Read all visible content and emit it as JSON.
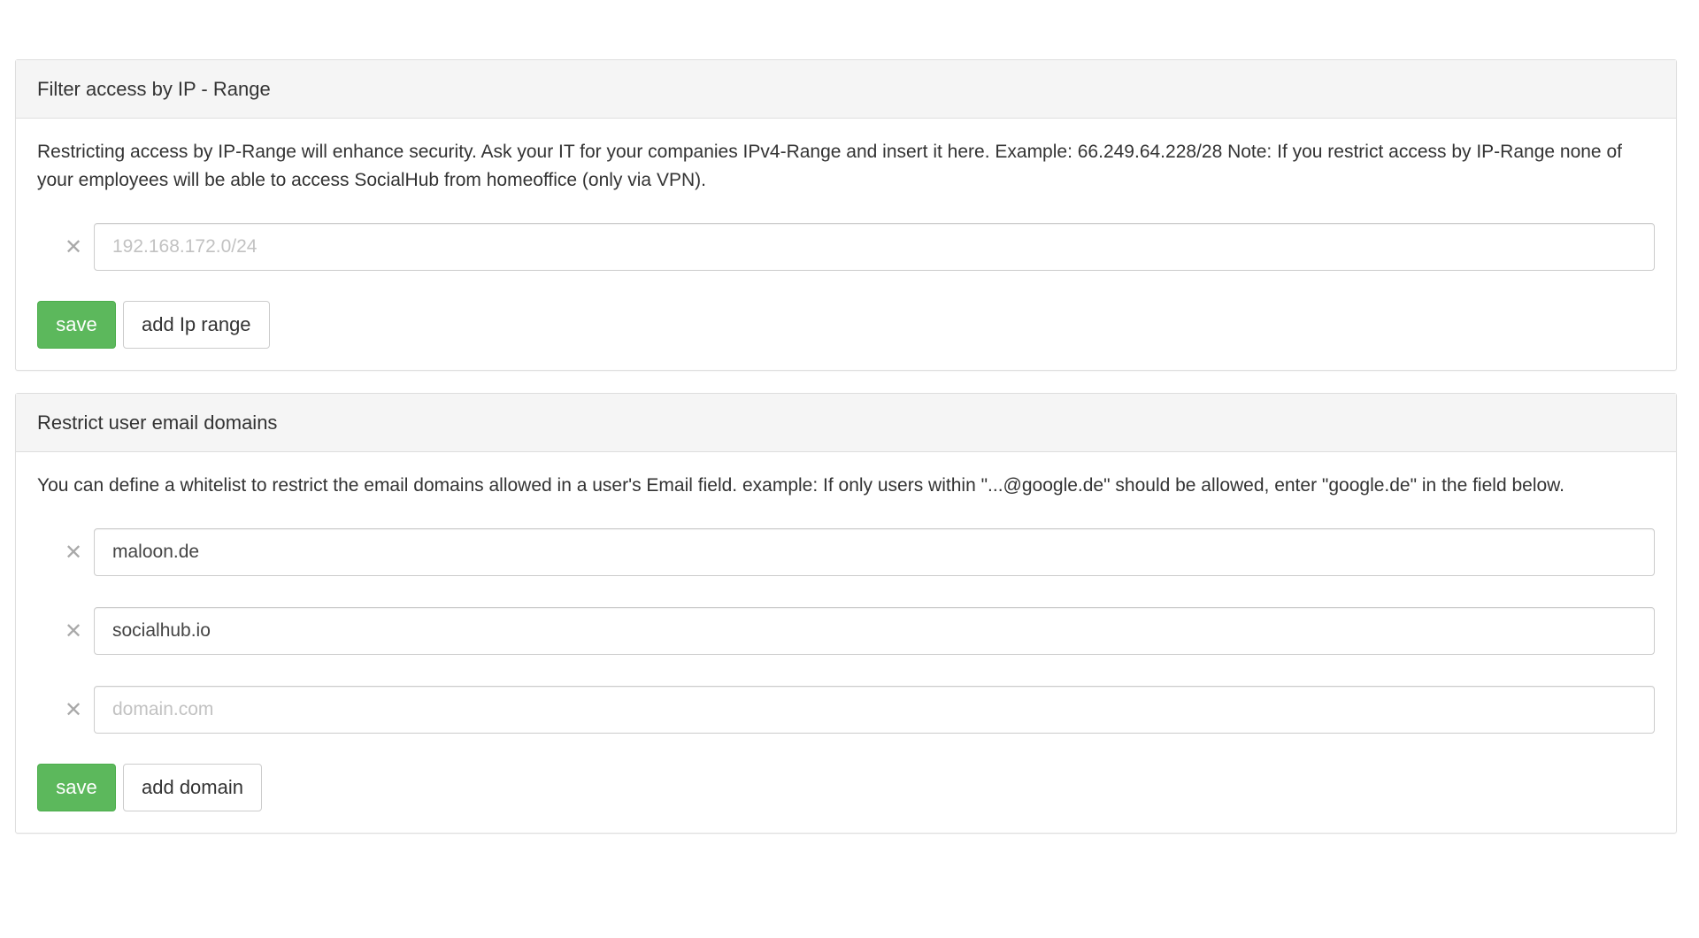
{
  "ip_panel": {
    "title": "Filter access by IP - Range",
    "description": "Restricting access by IP-Range will enhance security. Ask your IT for your companies IPv4-Range and insert it here. Example: 66.249.64.228/28 Note: If you restrict access by IP-Range none of your employees will be able to access SocialHub from homeoffice (only via VPN).",
    "fields": [
      {
        "value": "",
        "placeholder": "192.168.172.0/24"
      }
    ],
    "save_label": "save",
    "add_label": "add Ip range",
    "remove_glyph": "✕"
  },
  "email_panel": {
    "title": "Restrict user email domains",
    "description": "You can define a whitelist to restrict the email domains allowed in a user's Email field. example: If only users within \"...@google.de\" should be allowed, enter \"google.de\" in the field below.",
    "fields": [
      {
        "value": "maloon.de",
        "placeholder": ""
      },
      {
        "value": "socialhub.io",
        "placeholder": ""
      },
      {
        "value": "",
        "placeholder": "domain.com"
      }
    ],
    "save_label": "save",
    "add_label": "add domain",
    "remove_glyph": "✕"
  },
  "colors": {
    "success": "#5cb85c",
    "panel_heading_bg": "#f5f5f5",
    "border": "#dedede"
  },
  "icons": {
    "remove": "close-icon"
  }
}
